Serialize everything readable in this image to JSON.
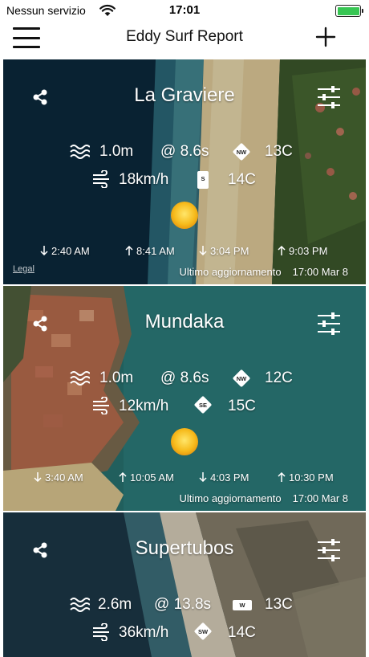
{
  "status_bar": {
    "carrier": "Nessun servizio",
    "time": "17:01",
    "battery_color": "#37c653"
  },
  "nav": {
    "title": "Eddy Surf Report",
    "menu_icon": "hamburger-menu-icon",
    "add_icon": "plus-icon"
  },
  "spots": [
    {
      "name": "La Graviere",
      "swell_height": "1.0m",
      "swell_period": "@ 8.6s",
      "swell_direction": "NW",
      "water_temp": "13C",
      "wind_speed": "18km/h",
      "wind_direction": "S",
      "air_temp": "14C",
      "weather": "sunny",
      "tides": [
        {
          "direction": "down",
          "time": "2:40 AM"
        },
        {
          "direction": "up",
          "time": "8:41 AM"
        },
        {
          "direction": "down",
          "time": "3:04 PM"
        },
        {
          "direction": "up",
          "time": "9:03 PM"
        }
      ],
      "updated_label": "Ultimo aggiornamento",
      "updated_time": "17:00 Mar 8",
      "map_legal": "Legal"
    },
    {
      "name": "Mundaka",
      "swell_height": "1.0m",
      "swell_period": "@ 8.6s",
      "swell_direction": "NW",
      "water_temp": "12C",
      "wind_speed": "12km/h",
      "wind_direction": "SE",
      "air_temp": "15C",
      "weather": "sunny",
      "tides": [
        {
          "direction": "down",
          "time": "3:40 AM"
        },
        {
          "direction": "up",
          "time": "10:05 AM"
        },
        {
          "direction": "down",
          "time": "4:03 PM"
        },
        {
          "direction": "up",
          "time": "10:30 PM"
        }
      ],
      "updated_label": "Ultimo aggiornamento",
      "updated_time": "17:00 Mar 8"
    },
    {
      "name": "Supertubos",
      "swell_height": "2.6m",
      "swell_period": "@ 13.8s",
      "swell_direction": "W",
      "water_temp": "13C",
      "wind_speed": "36km/h",
      "wind_direction": "SW",
      "air_temp": "14C"
    }
  ]
}
